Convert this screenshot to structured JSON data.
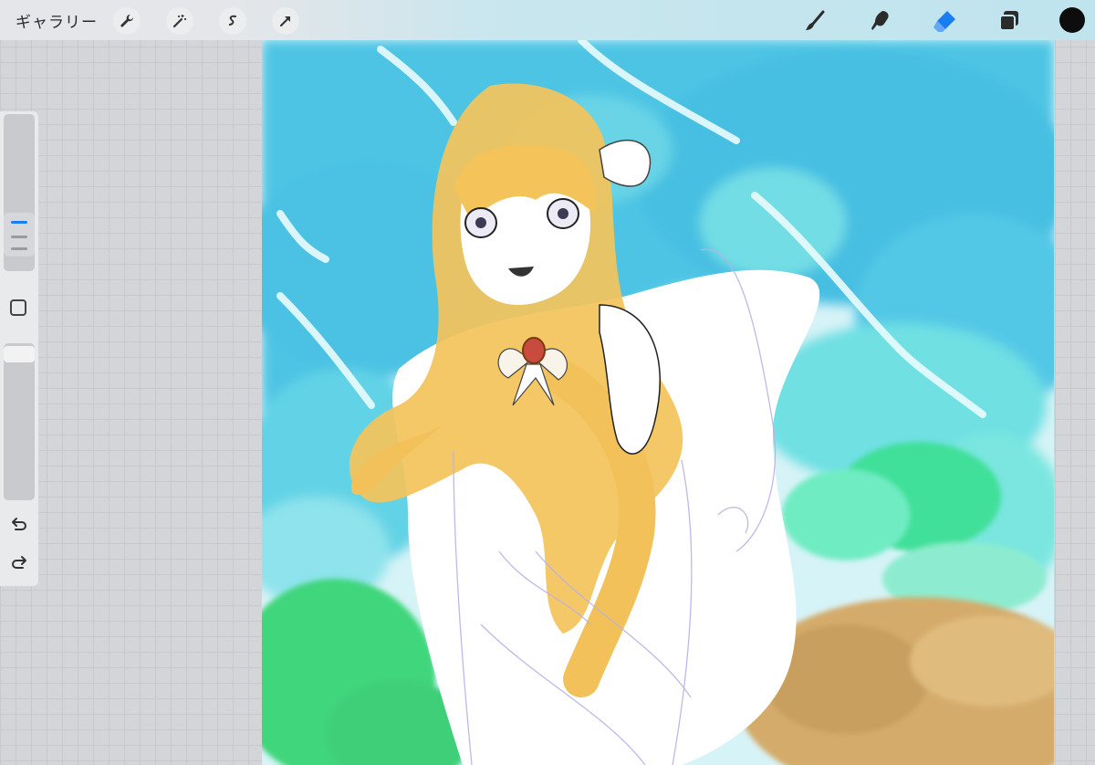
{
  "toolbar": {
    "gallery_label": "ギャラリー",
    "left_tools": [
      "wrench-icon",
      "magic-wand-icon",
      "selection-icon",
      "transform-arrow-icon"
    ],
    "right_tools": [
      "brush-icon",
      "smudge-icon",
      "eraser-icon",
      "layers-icon"
    ],
    "active_tool": "eraser-icon",
    "current_color": "#0d0d0d"
  },
  "sidebar": {
    "controls": [
      "brush-size-slider",
      "modify-button",
      "opacity-slider",
      "undo-icon",
      "redo-icon"
    ]
  },
  "colors": {
    "accent": "#1a7ef2",
    "sky": "#4ec4e4",
    "hair": "#f4c35a"
  }
}
